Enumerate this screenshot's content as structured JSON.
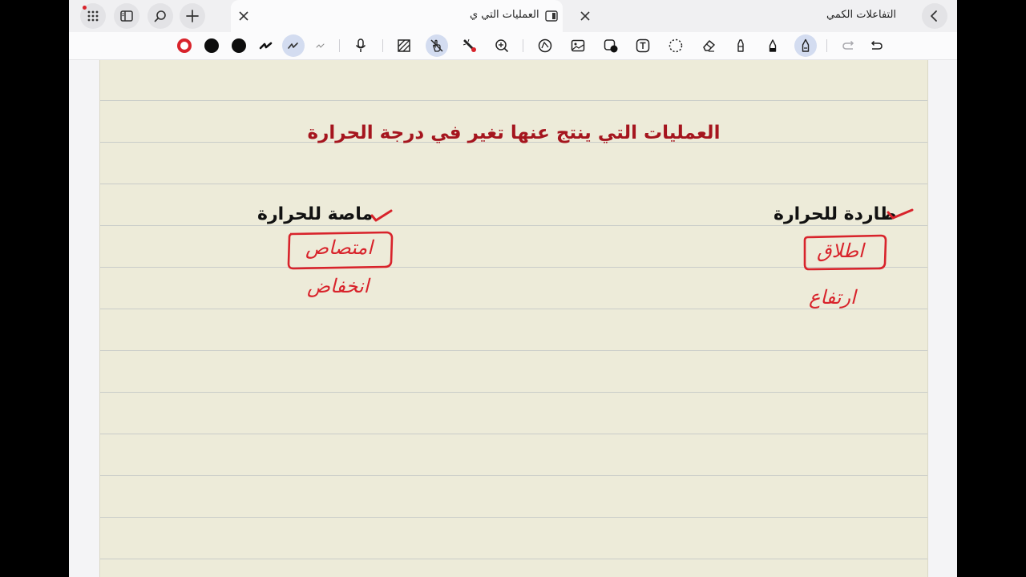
{
  "tabs": [
    {
      "label": "العمليات التي ي",
      "active": true
    },
    {
      "label": "التفاعلات الكمي",
      "active": false
    }
  ],
  "toolbar": {
    "tools": [
      "pen-icon",
      "black-color-swatch",
      "black-color-swatch-2",
      "stroke-thin-icon",
      "stroke-medium-icon",
      "stroke-thick-icon",
      "microphone-icon",
      "pattern-icon",
      "touch-disabled-icon",
      "laser-pointer-icon",
      "zoom-icon",
      "shape-icon",
      "image-icon",
      "sticker-icon",
      "text-icon",
      "lasso-icon",
      "eraser-icon",
      "highlighter-icon",
      "pencil-icon",
      "pen-tool-icon",
      "undo-icon",
      "redo-icon"
    ]
  },
  "colors": {
    "accent": "#a5151e",
    "ink_red": "#d8232b",
    "paper": "#edebd9"
  },
  "note": {
    "title": "العمليات التي ينتج عنها تغير في درجة الحرارة",
    "left_heading": "ماصة للحرارة",
    "right_heading": "طاردة للحرارة",
    "left_handwriting": [
      "امتصاص",
      "انخفاض"
    ],
    "right_handwriting": [
      "اطلاق",
      "ارتفاع"
    ]
  }
}
